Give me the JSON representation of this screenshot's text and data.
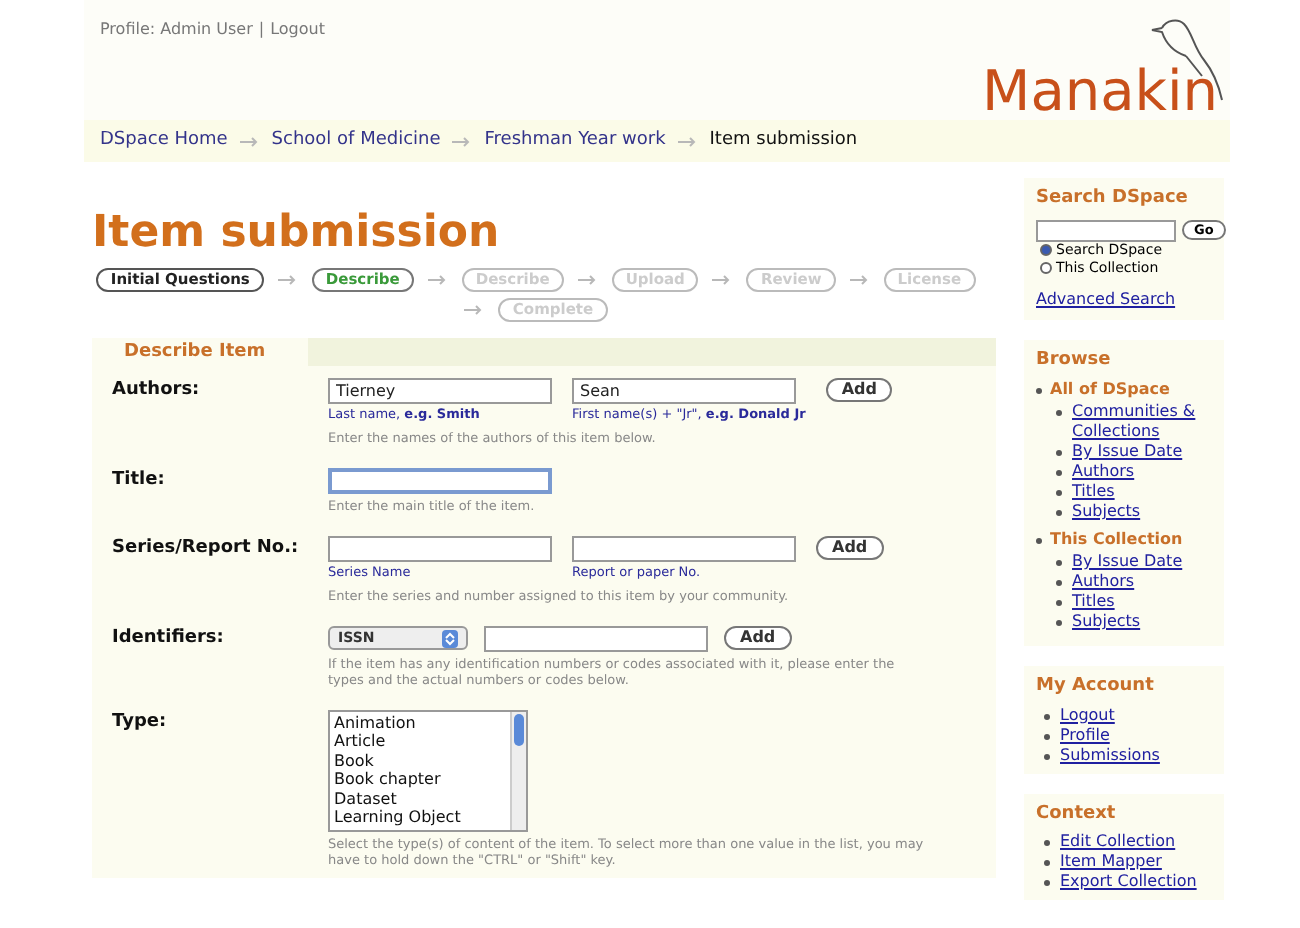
{
  "user_nav": {
    "profile": "Profile: Admin User",
    "separator": "|",
    "logout": "Logout"
  },
  "logo": "Manakin",
  "breadcrumbs": [
    {
      "label": "DSpace Home",
      "current": false
    },
    {
      "label": "School of Medicine",
      "current": false
    },
    {
      "label": "Freshman Year work",
      "current": false
    },
    {
      "label": "Item submission",
      "current": true
    }
  ],
  "page_title": "Item submission",
  "steps": [
    {
      "label": "Initial Questions",
      "kind": "done"
    },
    {
      "label": "Describe",
      "kind": "current"
    },
    {
      "label": "Describe",
      "kind": "disabled"
    },
    {
      "label": "Upload",
      "kind": "disabled"
    },
    {
      "label": "Review",
      "kind": "disabled"
    },
    {
      "label": "License",
      "kind": "disabled"
    },
    {
      "label": "Complete",
      "kind": "disabled"
    }
  ],
  "section_title": "Describe Item",
  "fields": [
    {
      "kind": "pair",
      "label": "Authors:",
      "inputs": [
        {
          "value": "Tierney",
          "caption": "Last name, **e.g. Smith**"
        },
        {
          "value": "Sean",
          "caption": "First name(s) + \"Jr\", **e.g. Donald Jr**"
        }
      ],
      "button": "Add",
      "help": "Enter the names of the authors of this item below."
    },
    {
      "kind": "text",
      "label": "Title:",
      "focused": true,
      "help": "Enter the main title of the item."
    },
    {
      "kind": "pair",
      "label": "Series/Report No.:",
      "inputs": [
        {
          "caption": "Series Name"
        },
        {
          "caption": "Report or paper No."
        }
      ],
      "button": "Add",
      "help": "Enter the series and number assigned to this item by your community."
    },
    {
      "kind": "select_input",
      "label": "Identifiers:",
      "select": "ISSN",
      "button": "Add",
      "help": "If the item has any identification numbers or codes associated with it, please enter the types and the actual numbers or codes below."
    },
    {
      "kind": "listbox",
      "label": "Type:",
      "options": [
        "Animation",
        "Article",
        "Book",
        "Book chapter",
        "Dataset",
        "Learning Object"
      ],
      "help": "Select the type(s) of content of the item. To select more than one value in the list, you may have to hold down the \"CTRL\" or \"Shift\" key."
    }
  ],
  "search": {
    "title": "Search DSpace",
    "go": "Go",
    "options": [
      {
        "label": "Search DSpace",
        "selected": true
      },
      {
        "label": "This Collection",
        "selected": false
      }
    ],
    "advanced": "Advanced Search"
  },
  "browse": {
    "title": "Browse",
    "groups": [
      {
        "label": "All of DSpace",
        "items": [
          "Communities & Collections",
          "By Issue Date",
          "Authors",
          "Titles",
          "Subjects"
        ]
      },
      {
        "label": "This Collection",
        "items": [
          "By Issue Date",
          "Authors",
          "Titles",
          "Subjects"
        ]
      }
    ]
  },
  "my_account": {
    "title": "My Account",
    "items": [
      "Logout",
      "Profile",
      "Submissions"
    ]
  },
  "context": {
    "title": "Context",
    "items": [
      "Edit Collection",
      "Item Mapper",
      "Export Collection"
    ]
  }
}
